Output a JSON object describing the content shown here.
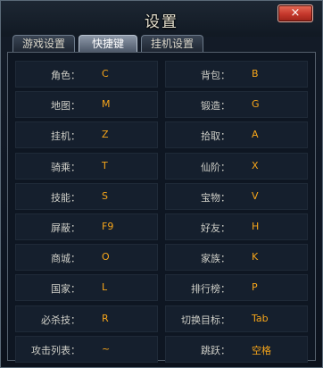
{
  "window": {
    "title": "设置",
    "close_label": "×"
  },
  "tabs": [
    {
      "label": "游戏设置",
      "active": false
    },
    {
      "label": "快捷键",
      "active": true
    },
    {
      "label": "挂机设置",
      "active": false
    }
  ],
  "shortcuts": [
    {
      "left": {
        "label": "角色：",
        "key": "C"
      },
      "right": {
        "label": "背包：",
        "key": "B"
      }
    },
    {
      "left": {
        "label": "地图：",
        "key": "M"
      },
      "right": {
        "label": "锻造：",
        "key": "G"
      }
    },
    {
      "left": {
        "label": "挂机：",
        "key": "Z"
      },
      "right": {
        "label": "拾取：",
        "key": "A"
      }
    },
    {
      "left": {
        "label": "骑乘：",
        "key": "T"
      },
      "right": {
        "label": "仙阶：",
        "key": "X"
      }
    },
    {
      "left": {
        "label": "技能：",
        "key": "S"
      },
      "right": {
        "label": "宝物：",
        "key": "V"
      }
    },
    {
      "left": {
        "label": "屏蔽：",
        "key": "F9"
      },
      "right": {
        "label": "好友：",
        "key": "H"
      }
    },
    {
      "left": {
        "label": "商城：",
        "key": "O"
      },
      "right": {
        "label": "家族：",
        "key": "K"
      }
    },
    {
      "left": {
        "label": "国家：",
        "key": "L"
      },
      "right": {
        "label": "排行榜：",
        "key": "P"
      }
    },
    {
      "left": {
        "label": "必杀技：",
        "key": "R"
      },
      "right": {
        "label": "切换目标：",
        "key": "Tab"
      }
    },
    {
      "left": {
        "label": "攻击列表：",
        "key": "~"
      },
      "right": {
        "label": "跳跃：",
        "key": "空格"
      }
    }
  ],
  "colors": {
    "key_text": "#f6a51a",
    "label_text": "#cfcfc8",
    "close_button": "#c4372b"
  }
}
